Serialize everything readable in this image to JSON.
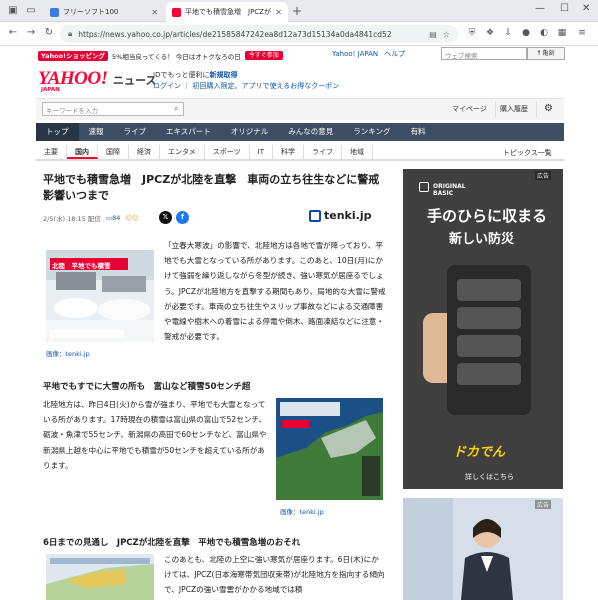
{
  "browser": {
    "tabs": [
      {
        "title": "フリーソフト100",
        "active": false
      },
      {
        "title": "平地でも積雪急増　JPCZが北陸",
        "active": true
      }
    ],
    "new_tab": "+",
    "url": "https://news.yahoo.co.jp/articles/de21585847242ea8d12a73d15134a0da4841cd52"
  },
  "header": {
    "promo_badge": "Yahoo!ショッピング",
    "promo_text": "5%相当戻ってくる！ 今日はオトクなろの日",
    "promo_button": "今すぐ参加",
    "links": [
      "Yahoo! JAPAN",
      "ヘルプ"
    ],
    "search_placeholder": "ウェブ検索",
    "search_button": "ｻ 亀刻",
    "logo": "YAHOO!",
    "logo_sub": "JAPAN",
    "news_label": "ニュース",
    "login_text_a": "IDでもっと便利に",
    "login_text_b": "新規取得",
    "login_line2": "ログイン ｜ 初回購入限定。アプリで使えるお得なクーポン",
    "keyword_placeholder": "キーワードを入力",
    "mypage": "マイページ",
    "history": "購入履歴"
  },
  "nav": {
    "categories": [
      "トップ",
      "速報",
      "ライブ",
      "エキスパート",
      "オリジナル",
      "みんなの意見",
      "ランキング",
      "有料"
    ],
    "subcategories": [
      "主要",
      "国内",
      "国際",
      "経済",
      "エンタメ",
      "スポーツ",
      "IT",
      "科学",
      "ライフ",
      "地域"
    ],
    "topics": "トピックス一覧"
  },
  "article": {
    "headline": "平地でも積雪急増　JPCZが北陸を直撃　車両の立ち往生などに警戒　影響いつまで",
    "date": "2/5(水) 18:15 配信",
    "comments": "84",
    "source": "tenki.jp",
    "image1_text": "北陸　平地でも積雪",
    "image1_caption": "画像：tenki.jp",
    "para1": "「立春大寒波」の影響で、北陸地方は各地で雪が降っており、平地でも大雪となっている所があります。このあと、10日(月)にかけて強弱を繰り返しながら冬型が続き、強い寒気が居座るでしょう。JPCZが北陸地方を直撃する期間もあり、局地的な大雪に警戒が必要です。車両の立ち往生やスリップ事故などによる交通障害や電線や樹木への着雪による停電や倒木、路面凍結などに注意・警戒が必要です。",
    "section1": "平地でもすでに大雪の所も　富山など積雪50センチ超",
    "para2": "北陸地方は、昨日4日(火)から雪が強まり、平地でも大雪となっている所があります。17時現在の積雪は富山県の富山で52センチ、砺波・魚津で55センチ、新潟県の高田で60センチなど、富山県や新潟県上越を中心に平地でも積雪が50センチを超えている所があります。",
    "image2_caption": "画像：tenki.jp",
    "section2": "6日までの見通し　JPCZが北陸を直撃　平地でも積雪急増のおそれ",
    "para3": "このあとも、北陸の上空に強い寒気が居座ります。6日(木)にかけては、JPCZ(日本海寒帯気団収束帯)が北陸地方を指向する傾向で、JPCZの強い雪雲がかかる地域では積"
  },
  "ads": {
    "label": "広告",
    "brand": "ORIGINAL BASIC",
    "headline1": "手のひらに収まる",
    "headline2": "新しい防災",
    "logo": "ドカでん",
    "cta": "詳しくはこちら"
  }
}
